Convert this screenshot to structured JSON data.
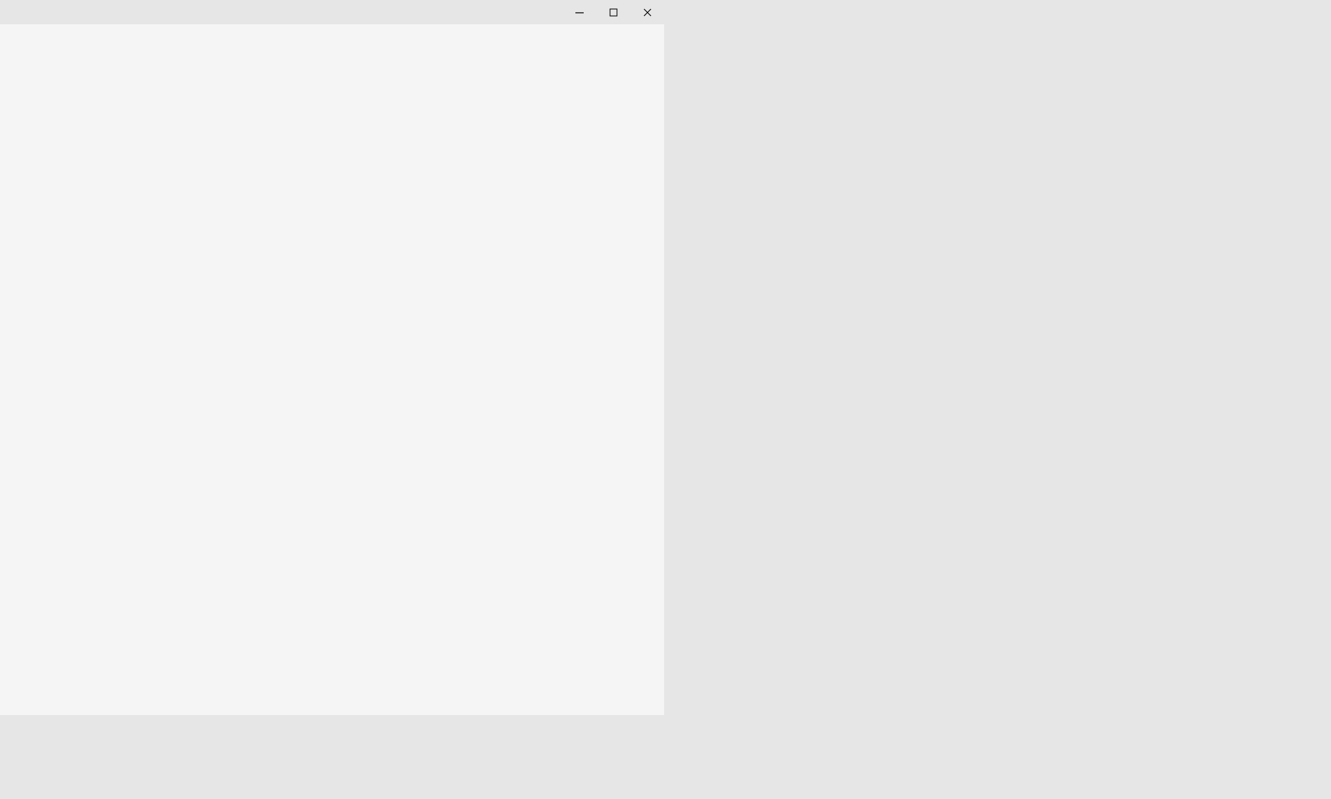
{
  "colors": {
    "desktop_background": "#e6e6e6",
    "titlebar_background": "#e6e6e6",
    "window_content_background": "#f5f5f5",
    "caption_icon_color": "#000000"
  },
  "window": {
    "title": "",
    "controls": [
      {
        "name": "minimize",
        "icon": "minimize-icon"
      },
      {
        "name": "maximize",
        "icon": "maximize-icon"
      },
      {
        "name": "close",
        "icon": "close-icon"
      }
    ]
  }
}
